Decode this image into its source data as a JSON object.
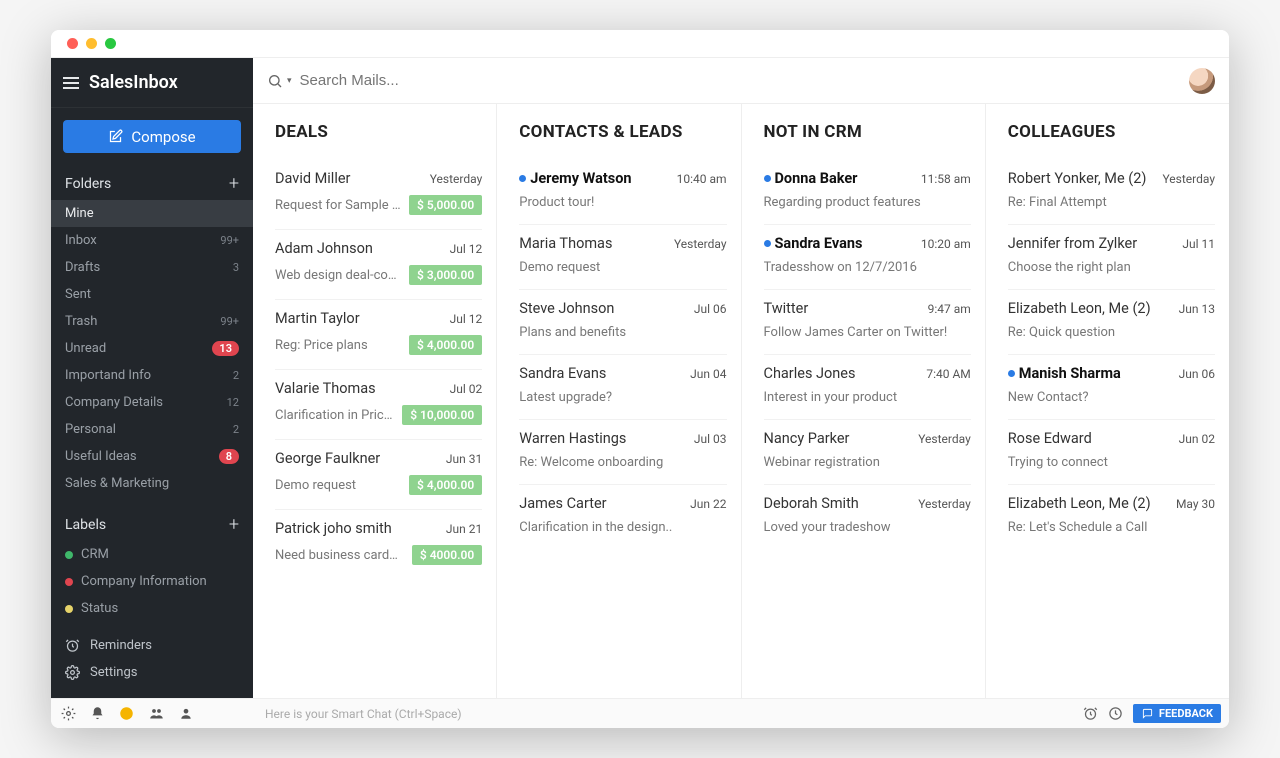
{
  "app": {
    "brand": "SalesInbox"
  },
  "compose": {
    "label": "Compose"
  },
  "sidebar": {
    "folders_heading": "Folders",
    "labels_heading": "Labels",
    "folders": [
      {
        "name": "Mine",
        "count": "",
        "active": true
      },
      {
        "name": "Inbox",
        "count": "99+"
      },
      {
        "name": "Drafts",
        "count": "3"
      },
      {
        "name": "Sent",
        "count": ""
      },
      {
        "name": "Trash",
        "count": "99+"
      },
      {
        "name": "Unread",
        "badge": "13"
      },
      {
        "name": "Importand Info",
        "count": "2"
      },
      {
        "name": "Company Details",
        "count": "12"
      },
      {
        "name": "Personal",
        "count": "2"
      },
      {
        "name": "Useful Ideas",
        "badge": "8"
      },
      {
        "name": "Sales & Marketing",
        "count": ""
      }
    ],
    "labels": [
      {
        "name": "CRM",
        "color": "#3fb76a"
      },
      {
        "name": "Company Information",
        "color": "#e0454f"
      },
      {
        "name": "Status",
        "color": "#e6d36a"
      }
    ],
    "reminders": "Reminders",
    "settings": "Settings"
  },
  "search": {
    "placeholder": "Search Mails..."
  },
  "columns": [
    {
      "title": "DEALS",
      "items": [
        {
          "sender": "David Miller",
          "time": "Yesterday",
          "subject": "Request for Sample logo...",
          "amount": "$ 5,000.00"
        },
        {
          "sender": "Adam Johnson",
          "time": "Jul 12",
          "subject": "Web design deal-confirma...",
          "amount": "$ 3,000.00"
        },
        {
          "sender": "Martin Taylor",
          "time": "Jul 12",
          "subject": "Reg: Price plans",
          "amount": "$ 4,000.00"
        },
        {
          "sender": "Valarie Thomas",
          "time": "Jul 02",
          "subject": "Clarification in Pricing",
          "amount": "$ 10,000.00"
        },
        {
          "sender": "George Faulkner",
          "time": "Jun 31",
          "subject": "Demo request",
          "amount": "$ 4,000.00"
        },
        {
          "sender": "Patrick joho smith",
          "time": "Jun 21",
          "subject": "Need business cards desi...",
          "amount": "$ 4000.00"
        }
      ]
    },
    {
      "title": "CONTACTS & LEADS",
      "items": [
        {
          "sender": "Jeremy Watson",
          "time": "10:40 am",
          "subject": "Product tour!",
          "unread": true
        },
        {
          "sender": "Maria Thomas",
          "time": "Yesterday",
          "subject": "Demo request"
        },
        {
          "sender": "Steve Johnson",
          "time": "Jul 06",
          "subject": "Plans and benefits"
        },
        {
          "sender": "Sandra Evans",
          "time": "Jun 04",
          "subject": "Latest upgrade?"
        },
        {
          "sender": "Warren Hastings",
          "time": "Jul 03",
          "subject": "Re: Welcome onboarding"
        },
        {
          "sender": "James Carter",
          "time": "Jun 22",
          "subject": "Clarification in the design.."
        }
      ]
    },
    {
      "title": "NOT IN CRM",
      "items": [
        {
          "sender": "Donna Baker",
          "time": "11:58 am",
          "subject": "Regarding product features",
          "unread": true
        },
        {
          "sender": "Sandra Evans",
          "time": "10:20 am",
          "subject": "Tradesshow on 12/7/2016",
          "unread": true
        },
        {
          "sender": "Twitter",
          "time": "9:47 am",
          "subject": "Follow James Carter on Twitter!"
        },
        {
          "sender": "Charles Jones",
          "time": "7:40 AM",
          "subject": "Interest in your product"
        },
        {
          "sender": "Nancy Parker",
          "time": "Yesterday",
          "subject": "Webinar registration"
        },
        {
          "sender": "Deborah Smith",
          "time": "Yesterday",
          "subject": "Loved your tradeshow"
        }
      ]
    },
    {
      "title": "COLLEAGUES",
      "items": [
        {
          "sender": "Robert Yonker, Me (2)",
          "time": "Yesterday",
          "subject": "Re: Final Attempt"
        },
        {
          "sender": "Jennifer from Zylker",
          "time": "Jul 11",
          "subject": "Choose the right plan"
        },
        {
          "sender": "Elizabeth Leon, Me (2)",
          "time": "Jun 13",
          "subject": "Re: Quick question"
        },
        {
          "sender": "Manish Sharma",
          "time": "Jun 06",
          "subject": "New Contact?",
          "unread": true
        },
        {
          "sender": "Rose Edward",
          "time": "Jun 02",
          "subject": "Trying to connect"
        },
        {
          "sender": "Elizabeth Leon, Me (2)",
          "time": "May 30",
          "subject": "Re: Let's Schedule a Call"
        }
      ]
    }
  ],
  "statusbar": {
    "chat_placeholder": "Here is your Smart Chat (Ctrl+Space)",
    "feedback": "FEEDBACK"
  }
}
